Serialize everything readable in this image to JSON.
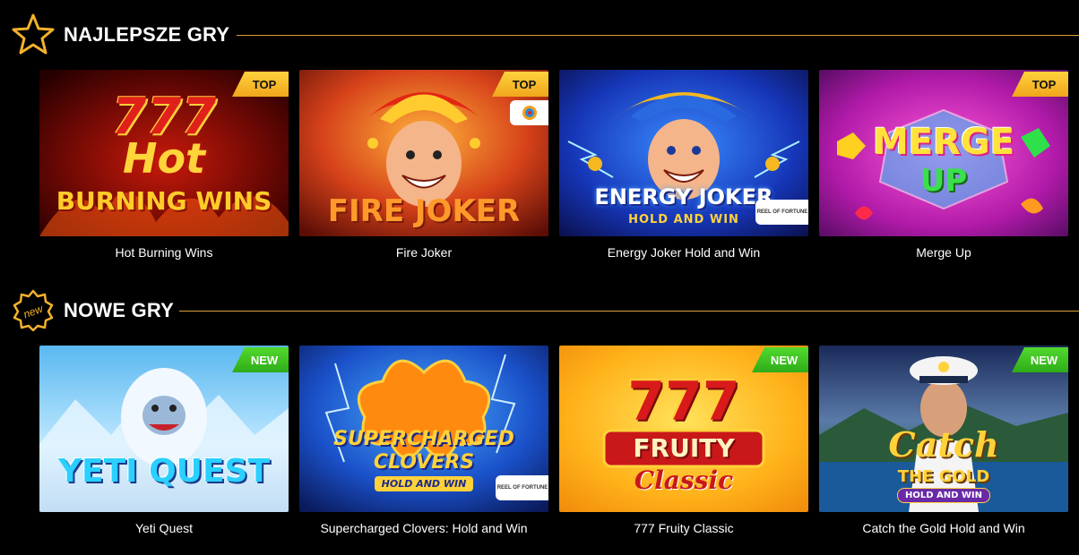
{
  "sections": [
    {
      "title": "NAJLEPSZE GRY",
      "icon": "star-icon",
      "games": [
        {
          "name": "Hot Burning Wins",
          "badge": "TOP",
          "art_line1": "777",
          "art_line2": "Hot",
          "art_line3": "BURNING WINS"
        },
        {
          "name": "Fire Joker",
          "badge": "TOP",
          "art_line1": "FIRE JOKER"
        },
        {
          "name": "Energy Joker Hold and Win",
          "badge": "",
          "art_line1": "ENERGY JOKER",
          "art_line2": "HOLD AND WIN",
          "provider": "REEL OF FORTUNE"
        },
        {
          "name": "Merge Up",
          "badge": "TOP",
          "art_line1": "MERGE",
          "art_line2": "UP"
        }
      ]
    },
    {
      "title": "NOWE GRY",
      "icon": "new-badge-icon",
      "icon_text": "new",
      "games": [
        {
          "name": "Yeti Quest",
          "badge": "NEW",
          "art_line1": "YETI QUEST"
        },
        {
          "name": "Supercharged Clovers: Hold and Win",
          "badge": "",
          "art_line1": "SUPERCHARGED",
          "art_line2": "CLOVERS",
          "art_line3": "HOLD AND WIN",
          "provider": "REEL OF FORTUNE"
        },
        {
          "name": "777 Fruity Classic",
          "badge": "NEW",
          "art_line1": "777",
          "art_line2": "FRUITY",
          "art_line3": "Classic"
        },
        {
          "name": "Catch the Gold Hold and Win",
          "badge": "NEW",
          "art_line1": "Catch",
          "art_line2": "THE GOLD",
          "art_line3": "HOLD AND WIN"
        }
      ]
    }
  ],
  "colors": {
    "accent": "#d8a038",
    "badge_top": "#f5b82a",
    "badge_new": "#3cc222",
    "background": "#000000"
  }
}
